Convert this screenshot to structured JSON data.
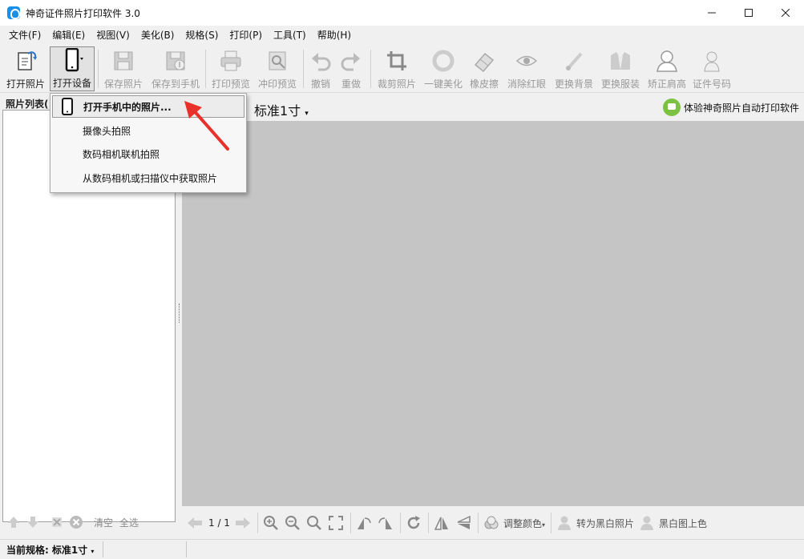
{
  "window": {
    "title": "神奇证件照片打印软件 3.0",
    "controls": [
      "minimize",
      "maximize",
      "close"
    ]
  },
  "menu": [
    "文件(F)",
    "编辑(E)",
    "视图(V)",
    "美化(B)",
    "规格(S)",
    "打印(P)",
    "工具(T)",
    "帮助(H)"
  ],
  "toolbar": {
    "open_photo": "打开照片",
    "open_device": "打开设备",
    "save_photo": "保存照片",
    "save_to_phone": "保存到手机",
    "print_preview": "打印预览",
    "develop_preview": "冲印预览",
    "undo": "撤销",
    "redo": "重做",
    "crop": "裁剪照片",
    "beautify": "一键美化",
    "eraser": "橡皮擦",
    "red_eye": "消除红眼",
    "change_bg": "更换背景",
    "change_clothes": "更换服装",
    "fix_shoulder": "矫正肩高",
    "id_number": "证件号码"
  },
  "left_panel": {
    "title": "照片列表(",
    "clear": "清空",
    "select_all": "全选"
  },
  "header": {
    "spec": "标准1寸",
    "promo": "体验神奇照片自动打印软件"
  },
  "device_menu": {
    "items": [
      "打开手机中的照片...",
      "摄像头拍照",
      "数码相机联机拍照",
      "从数码相机或扫描仪中获取照片"
    ]
  },
  "bottom_toolbar": {
    "page": "1 / 1",
    "adjust_color": "调整颜色",
    "to_bw": "转为黑白照片",
    "colorize": "黑白图上色"
  },
  "status": {
    "label": "当前规格:",
    "value": "标准1寸"
  }
}
